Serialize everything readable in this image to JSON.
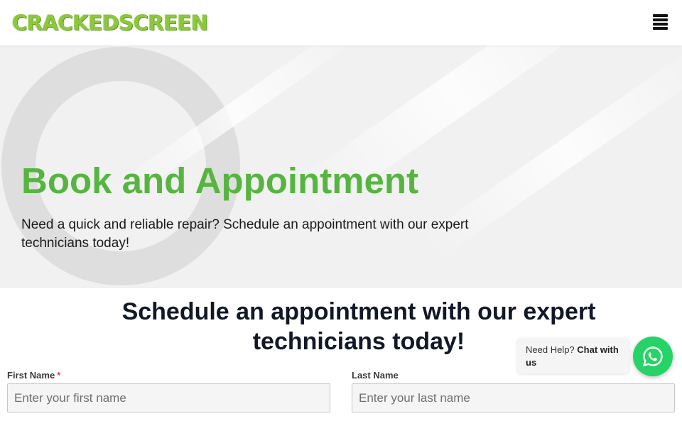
{
  "header": {
    "logo_text": "CRACKEDSCREEN",
    "menu_icon": "hamburger-menu-icon"
  },
  "hero": {
    "title": "Book and Appointment",
    "subtitle": "Need a quick and reliable repair? Schedule an appointment with our expert technicians today!"
  },
  "form": {
    "heading": "Schedule an appointment with our expert technicians today!",
    "first_name": {
      "label": "First Name",
      "required_mark": "*",
      "placeholder": "Enter your first name",
      "value": ""
    },
    "last_name": {
      "label": "Last Name",
      "placeholder": "Enter your last name",
      "value": ""
    }
  },
  "chat": {
    "prefix": "Need Help?",
    "link": "Chat with us",
    "icon": "whatsapp-icon"
  },
  "colors": {
    "brand_green": "#8dc63f",
    "title_green": "#56b540",
    "whatsapp_green": "#25d366"
  }
}
